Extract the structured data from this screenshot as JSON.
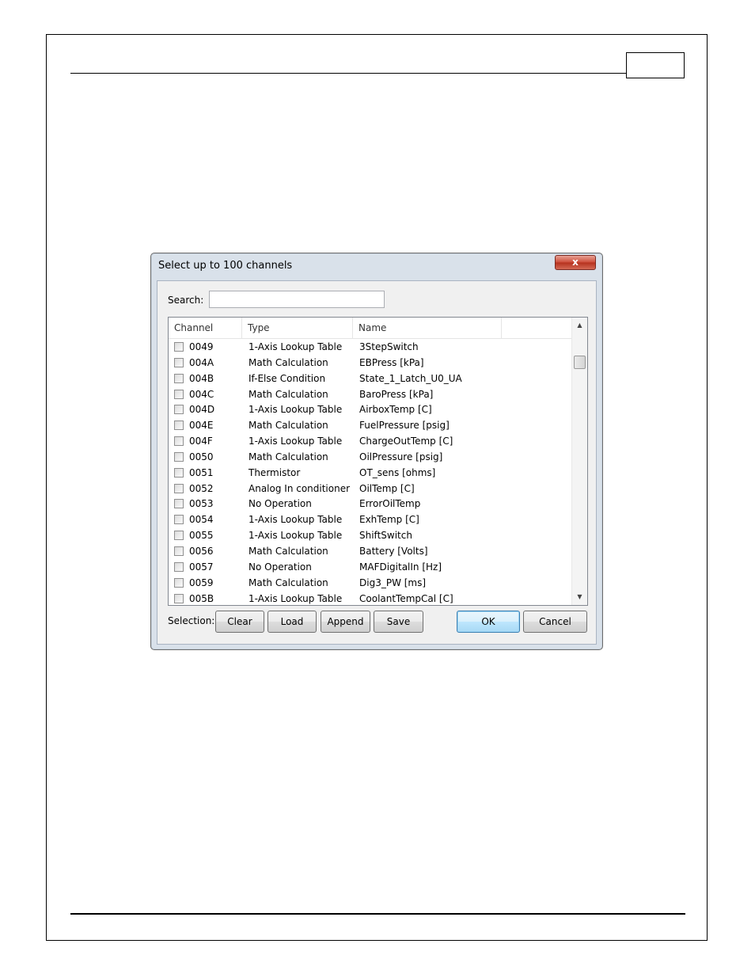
{
  "dialog": {
    "title": "Select up to 100 channels",
    "close_label": "x",
    "search_label": "Search:",
    "search_value": "",
    "columns": {
      "channel": "Channel",
      "type": "Type",
      "name": "Name"
    },
    "rows": [
      {
        "channel": "0049",
        "type": "1-Axis Lookup Table",
        "name": "3StepSwitch"
      },
      {
        "channel": "004A",
        "type": "Math Calculation",
        "name": "EBPress [kPa]"
      },
      {
        "channel": "004B",
        "type": "If-Else Condition",
        "name": "State_1_Latch_U0_UA"
      },
      {
        "channel": "004C",
        "type": "Math Calculation",
        "name": "BaroPress [kPa]"
      },
      {
        "channel": "004D",
        "type": "1-Axis Lookup Table",
        "name": "AirboxTemp [C]"
      },
      {
        "channel": "004E",
        "type": "Math Calculation",
        "name": "FuelPressure [psig]"
      },
      {
        "channel": "004F",
        "type": "1-Axis Lookup Table",
        "name": "ChargeOutTemp [C]"
      },
      {
        "channel": "0050",
        "type": "Math Calculation",
        "name": "OilPressure [psig]"
      },
      {
        "channel": "0051",
        "type": "Thermistor",
        "name": "OT_sens [ohms]"
      },
      {
        "channel": "0052",
        "type": "Analog In conditioner",
        "name": "OilTemp [C]"
      },
      {
        "channel": "0053",
        "type": "No Operation",
        "name": "ErrorOilTemp"
      },
      {
        "channel": "0054",
        "type": "1-Axis Lookup Table",
        "name": "ExhTemp [C]"
      },
      {
        "channel": "0055",
        "type": "1-Axis Lookup Table",
        "name": "ShiftSwitch"
      },
      {
        "channel": "0056",
        "type": "Math Calculation",
        "name": "Battery [Volts]"
      },
      {
        "channel": "0057",
        "type": "No Operation",
        "name": "MAFDigitalIn [Hz]"
      },
      {
        "channel": "0059",
        "type": "Math Calculation",
        "name": "Dig3_PW [ms]"
      },
      {
        "channel": "005B",
        "type": "1-Axis Lookup Table",
        "name": "CoolantTempCal [C]"
      }
    ],
    "selection_label": "Selection:",
    "buttons": {
      "clear": "Clear",
      "load": "Load",
      "append": "Append",
      "save": "Save",
      "ok": "OK",
      "cancel": "Cancel"
    }
  }
}
